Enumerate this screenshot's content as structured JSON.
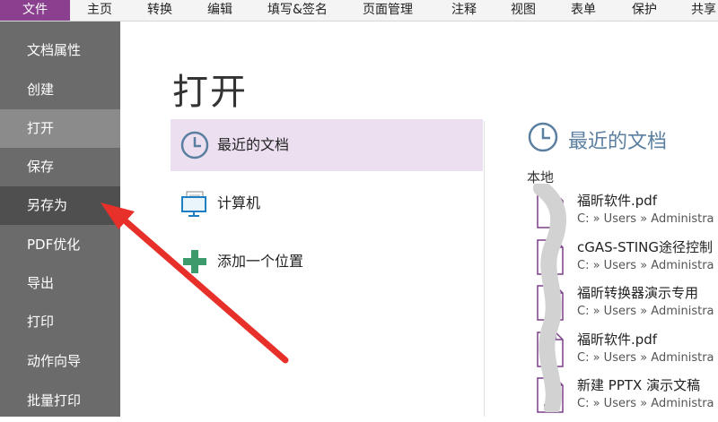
{
  "ribbon": {
    "tabs": [
      "文件",
      "主页",
      "转换",
      "编辑",
      "填写&签名",
      "页面管理",
      "注释",
      "视图",
      "表单",
      "保护",
      "共享"
    ]
  },
  "sidebar": {
    "items": [
      "文档属性",
      "创建",
      "打开",
      "保存",
      "另存为",
      "PDF优化",
      "导出",
      "打印",
      "动作向导",
      "批量打印"
    ],
    "active_item": "打开",
    "hovered_item": "另存为"
  },
  "main": {
    "title": "打开",
    "locations": [
      "最近的文档",
      "计算机",
      "添加一个位置"
    ],
    "selected_location": "最近的文档"
  },
  "recent": {
    "title": "最近的文档",
    "section": "本地",
    "docs": [
      {
        "name": "福昕软件.pdf",
        "path": "C: » Users » Administra"
      },
      {
        "name": "cGAS-STING途径控制",
        "path": "C: » Users » Administra"
      },
      {
        "name": "福昕转换器演示专用",
        "path": "C: » Users » Administra"
      },
      {
        "name": "福昕软件.pdf",
        "path": "C: » Users » Administra"
      },
      {
        "name": "新建 PPTX 演示文稿",
        "path": "C: » Users » Administra"
      }
    ],
    "file_icon_label": "PDF"
  },
  "colors": {
    "file_tab": "#8a3f8f",
    "sidebar": "#6b6b6b",
    "selection": "#ecdff0",
    "accent_blue": "#5a7fa0",
    "arrow": "#e8302a",
    "add_icon": "#3c9a6b"
  },
  "icons": [
    "clock-icon",
    "computer-icon",
    "add-location-icon",
    "pdf-file-icon",
    "red-arrow-annotation"
  ]
}
